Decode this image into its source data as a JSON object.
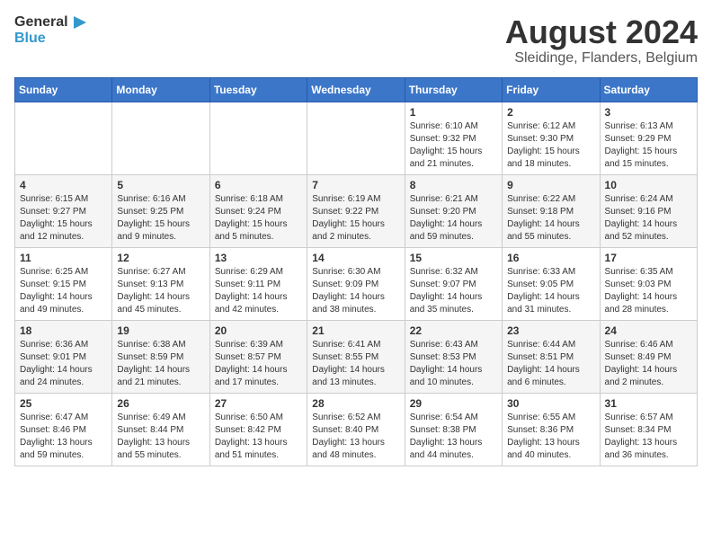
{
  "header": {
    "logo_general": "General",
    "logo_blue": "Blue",
    "title": "August 2024",
    "subtitle": "Sleidinge, Flanders, Belgium"
  },
  "weekdays": [
    "Sunday",
    "Monday",
    "Tuesday",
    "Wednesday",
    "Thursday",
    "Friday",
    "Saturday"
  ],
  "weeks": [
    [
      {
        "day": "",
        "info": ""
      },
      {
        "day": "",
        "info": ""
      },
      {
        "day": "",
        "info": ""
      },
      {
        "day": "",
        "info": ""
      },
      {
        "day": "1",
        "info": "Sunrise: 6:10 AM\nSunset: 9:32 PM\nDaylight: 15 hours\nand 21 minutes."
      },
      {
        "day": "2",
        "info": "Sunrise: 6:12 AM\nSunset: 9:30 PM\nDaylight: 15 hours\nand 18 minutes."
      },
      {
        "day": "3",
        "info": "Sunrise: 6:13 AM\nSunset: 9:29 PM\nDaylight: 15 hours\nand 15 minutes."
      }
    ],
    [
      {
        "day": "4",
        "info": "Sunrise: 6:15 AM\nSunset: 9:27 PM\nDaylight: 15 hours\nand 12 minutes."
      },
      {
        "day": "5",
        "info": "Sunrise: 6:16 AM\nSunset: 9:25 PM\nDaylight: 15 hours\nand 9 minutes."
      },
      {
        "day": "6",
        "info": "Sunrise: 6:18 AM\nSunset: 9:24 PM\nDaylight: 15 hours\nand 5 minutes."
      },
      {
        "day": "7",
        "info": "Sunrise: 6:19 AM\nSunset: 9:22 PM\nDaylight: 15 hours\nand 2 minutes."
      },
      {
        "day": "8",
        "info": "Sunrise: 6:21 AM\nSunset: 9:20 PM\nDaylight: 14 hours\nand 59 minutes."
      },
      {
        "day": "9",
        "info": "Sunrise: 6:22 AM\nSunset: 9:18 PM\nDaylight: 14 hours\nand 55 minutes."
      },
      {
        "day": "10",
        "info": "Sunrise: 6:24 AM\nSunset: 9:16 PM\nDaylight: 14 hours\nand 52 minutes."
      }
    ],
    [
      {
        "day": "11",
        "info": "Sunrise: 6:25 AM\nSunset: 9:15 PM\nDaylight: 14 hours\nand 49 minutes."
      },
      {
        "day": "12",
        "info": "Sunrise: 6:27 AM\nSunset: 9:13 PM\nDaylight: 14 hours\nand 45 minutes."
      },
      {
        "day": "13",
        "info": "Sunrise: 6:29 AM\nSunset: 9:11 PM\nDaylight: 14 hours\nand 42 minutes."
      },
      {
        "day": "14",
        "info": "Sunrise: 6:30 AM\nSunset: 9:09 PM\nDaylight: 14 hours\nand 38 minutes."
      },
      {
        "day": "15",
        "info": "Sunrise: 6:32 AM\nSunset: 9:07 PM\nDaylight: 14 hours\nand 35 minutes."
      },
      {
        "day": "16",
        "info": "Sunrise: 6:33 AM\nSunset: 9:05 PM\nDaylight: 14 hours\nand 31 minutes."
      },
      {
        "day": "17",
        "info": "Sunrise: 6:35 AM\nSunset: 9:03 PM\nDaylight: 14 hours\nand 28 minutes."
      }
    ],
    [
      {
        "day": "18",
        "info": "Sunrise: 6:36 AM\nSunset: 9:01 PM\nDaylight: 14 hours\nand 24 minutes."
      },
      {
        "day": "19",
        "info": "Sunrise: 6:38 AM\nSunset: 8:59 PM\nDaylight: 14 hours\nand 21 minutes."
      },
      {
        "day": "20",
        "info": "Sunrise: 6:39 AM\nSunset: 8:57 PM\nDaylight: 14 hours\nand 17 minutes."
      },
      {
        "day": "21",
        "info": "Sunrise: 6:41 AM\nSunset: 8:55 PM\nDaylight: 14 hours\nand 13 minutes."
      },
      {
        "day": "22",
        "info": "Sunrise: 6:43 AM\nSunset: 8:53 PM\nDaylight: 14 hours\nand 10 minutes."
      },
      {
        "day": "23",
        "info": "Sunrise: 6:44 AM\nSunset: 8:51 PM\nDaylight: 14 hours\nand 6 minutes."
      },
      {
        "day": "24",
        "info": "Sunrise: 6:46 AM\nSunset: 8:49 PM\nDaylight: 14 hours\nand 2 minutes."
      }
    ],
    [
      {
        "day": "25",
        "info": "Sunrise: 6:47 AM\nSunset: 8:46 PM\nDaylight: 13 hours\nand 59 minutes."
      },
      {
        "day": "26",
        "info": "Sunrise: 6:49 AM\nSunset: 8:44 PM\nDaylight: 13 hours\nand 55 minutes."
      },
      {
        "day": "27",
        "info": "Sunrise: 6:50 AM\nSunset: 8:42 PM\nDaylight: 13 hours\nand 51 minutes."
      },
      {
        "day": "28",
        "info": "Sunrise: 6:52 AM\nSunset: 8:40 PM\nDaylight: 13 hours\nand 48 minutes."
      },
      {
        "day": "29",
        "info": "Sunrise: 6:54 AM\nSunset: 8:38 PM\nDaylight: 13 hours\nand 44 minutes."
      },
      {
        "day": "30",
        "info": "Sunrise: 6:55 AM\nSunset: 8:36 PM\nDaylight: 13 hours\nand 40 minutes."
      },
      {
        "day": "31",
        "info": "Sunrise: 6:57 AM\nSunset: 8:34 PM\nDaylight: 13 hours\nand 36 minutes."
      }
    ]
  ]
}
